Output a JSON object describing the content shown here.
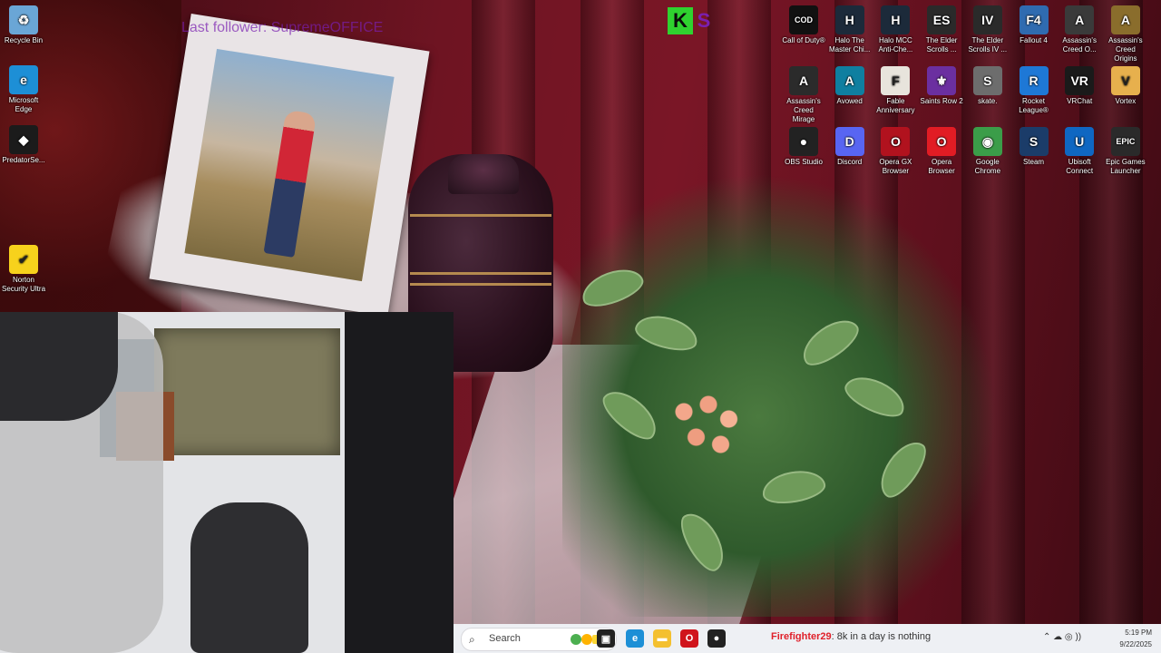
{
  "overlay": {
    "last_follower_text": "Last follower: SupremeOFFICE"
  },
  "kick_logo": {
    "letters": "K",
    "second": "S"
  },
  "desktop_icons_left": [
    {
      "id": "recycle-bin",
      "label": "Recycle Bin",
      "icon": "recycle-bin-icon",
      "color": "#6aa6d6",
      "glyph": "♻"
    },
    {
      "id": "microsoft-edge",
      "label": "Microsoft Edge",
      "icon": "edge-icon",
      "color": "#1d8fd6",
      "glyph": "e"
    },
    {
      "id": "predatorsense",
      "label": "PredatorSe...",
      "icon": "predator-icon",
      "color": "#1b1b1b",
      "glyph": "◆"
    },
    {
      "id": "norton",
      "label": "Norton Security Ultra",
      "icon": "norton-icon",
      "color": "#f7d21c",
      "glyph": "✔"
    }
  ],
  "desktop_icons_right": [
    {
      "id": "call-of-duty",
      "label": "Call of Duty®",
      "icon": "cod-icon",
      "color": "#111",
      "glyph": "COD"
    },
    {
      "id": "halo-mcc-1",
      "label": "Halo The Master Chi...",
      "icon": "halo-icon",
      "color": "#1c2a3a",
      "glyph": "H"
    },
    {
      "id": "halo-mcc-2",
      "label": "Halo MCC Anti-Che...",
      "icon": "halo-icon",
      "color": "#1c2a3a",
      "glyph": "H"
    },
    {
      "id": "elder-scrolls-1",
      "label": "The Elder Scrolls ...",
      "icon": "elder-scrolls-icon",
      "color": "#2a2a2a",
      "glyph": "ES"
    },
    {
      "id": "elder-scrolls-4",
      "label": "The Elder Scrolls IV ...",
      "icon": "elder-scrolls-icon",
      "color": "#2a2a2a",
      "glyph": "IV"
    },
    {
      "id": "fallout-4",
      "label": "Fallout 4",
      "icon": "fallout-icon",
      "color": "#2f6bb0",
      "glyph": "F4"
    },
    {
      "id": "ac-odyssey",
      "label": "Assassin's Creed O...",
      "icon": "assassins-creed-icon",
      "color": "#3a3a3a",
      "glyph": "A"
    },
    {
      "id": "ac-origins",
      "label": "Assassin's Creed Origins",
      "icon": "assassins-creed-icon",
      "color": "#8a6d2c",
      "glyph": "A"
    },
    {
      "id": "ac-mirage",
      "label": "Assassin's Creed Mirage",
      "icon": "assassins-creed-icon",
      "color": "#2b2b2b",
      "glyph": "A"
    },
    {
      "id": "avowed",
      "label": "Avowed",
      "icon": "avowed-icon",
      "color": "#0f7fa0",
      "glyph": "A"
    },
    {
      "id": "fable",
      "label": "Fable Anniversary",
      "icon": "fable-icon",
      "color": "#e8e4dc",
      "glyph": "F"
    },
    {
      "id": "saints-row",
      "label": "Saints Row 2",
      "icon": "saints-row-icon",
      "color": "#6b2fa0",
      "glyph": "⚜"
    },
    {
      "id": "skate",
      "label": "skate.",
      "icon": "skate-icon",
      "color": "#6d6d6d",
      "glyph": "S"
    },
    {
      "id": "rocket-league",
      "label": "Rocket League®",
      "icon": "rocket-league-icon",
      "color": "#1e78d6",
      "glyph": "R"
    },
    {
      "id": "vrchat",
      "label": "VRChat",
      "icon": "vrchat-icon",
      "color": "#1a1a1a",
      "glyph": "VR"
    },
    {
      "id": "vortex",
      "label": "Vortex",
      "icon": "vortex-icon",
      "color": "#e7b04d",
      "glyph": "V"
    },
    {
      "id": "obs",
      "label": "OBS Studio",
      "icon": "obs-icon",
      "color": "#222",
      "glyph": "●"
    },
    {
      "id": "discord",
      "label": "Discord",
      "icon": "discord-icon",
      "color": "#5865f2",
      "glyph": "D"
    },
    {
      "id": "opera-gx",
      "label": "Opera GX Browser",
      "icon": "opera-gx-icon",
      "color": "#b1121e",
      "glyph": "O"
    },
    {
      "id": "opera",
      "label": "Opera Browser",
      "icon": "opera-icon",
      "color": "#e11c24",
      "glyph": "O"
    },
    {
      "id": "chrome",
      "label": "Google Chrome",
      "icon": "chrome-icon",
      "color": "#3b9d49",
      "glyph": "◉"
    },
    {
      "id": "steam",
      "label": "Steam",
      "icon": "steam-icon",
      "color": "#1b3c69",
      "glyph": "S"
    },
    {
      "id": "ubisoft",
      "label": "Ubisoft Connect",
      "icon": "ubisoft-icon",
      "color": "#0f67c2",
      "glyph": "U"
    },
    {
      "id": "epic",
      "label": "Epic Games Launcher",
      "icon": "epic-games-icon",
      "color": "#2a2a2a",
      "glyph": "EPIC"
    }
  ],
  "taskbar": {
    "search_placeholder": "Search",
    "apps": [
      {
        "id": "task-view",
        "icon": "task-view-icon",
        "color": "#222",
        "glyph": "▣"
      },
      {
        "id": "edge",
        "icon": "edge-icon",
        "color": "#1d8fd6",
        "glyph": "e"
      },
      {
        "id": "file-explorer",
        "icon": "folder-icon",
        "color": "#f4c02f",
        "glyph": "▬"
      },
      {
        "id": "opera-gx",
        "icon": "opera-gx-icon",
        "color": "#d0141c",
        "glyph": "O"
      },
      {
        "id": "obs",
        "icon": "obs-icon",
        "color": "#222",
        "glyph": "●"
      }
    ],
    "chat": {
      "username": "Firefighter29",
      "message": ": 8k in a day is nothing"
    },
    "tray": "⌃  ☁  ◎  ))",
    "clock": {
      "time": "5:19 PM",
      "date": "9/22/2025"
    }
  }
}
